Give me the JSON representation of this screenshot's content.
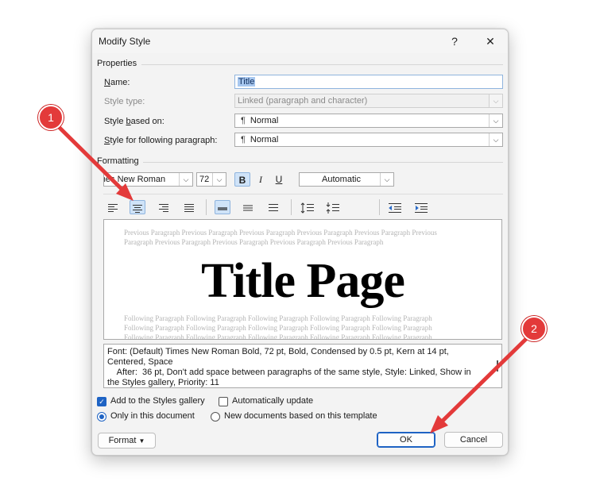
{
  "dialog": {
    "title": "Modify Style",
    "help_glyph": "?",
    "close_glyph": "✕"
  },
  "properties": {
    "group_label": "Properties",
    "name_label": "Name:",
    "name_value": "Title",
    "style_type_label": "Style type:",
    "style_type_value": "Linked (paragraph and character)",
    "based_on_label": "Style based on:",
    "based_on_value": "Normal",
    "following_label": "Style for following paragraph:",
    "following_value": "Normal",
    "para_glyph": "¶"
  },
  "formatting": {
    "group_label": "Formatting",
    "font_value": "Times New Roman",
    "size_value": "72",
    "bold_label": "B",
    "italic_label": "I",
    "underline_label": "U",
    "color_value": "Automatic"
  },
  "preview": {
    "previous_line1": "Previous Paragraph Previous Paragraph Previous Paragraph Previous Paragraph Previous Paragraph Previous",
    "previous_line2": "Paragraph Previous Paragraph Previous Paragraph Previous Paragraph Previous Paragraph",
    "title_text": "Title Page",
    "following_line1": "Following Paragraph Following Paragraph Following Paragraph Following Paragraph Following Paragraph",
    "following_line2": "Following Paragraph Following Paragraph Following Paragraph Following Paragraph Following Paragraph",
    "following_line3": "Following Paragraph Following Paragraph Following Paragraph Following Paragraph Following Paragraph"
  },
  "description": {
    "line1": "Font: (Default) Times New Roman Bold, 72 pt, Bold, Condensed by  0.5 pt, Kern at 14 pt,",
    "line2": "Centered, Space",
    "line3": "    After:  36 pt, Don't add space between paragraphs of the same style, Style: Linked, Show in",
    "line4": "the Styles gallery, Priority: 11"
  },
  "options": {
    "add_gallery_label": "Add to the Styles gallery",
    "add_gallery_checked": true,
    "auto_update_label": "Automatically update",
    "auto_update_checked": false,
    "only_doc_label": "Only in this document",
    "new_docs_label": "New documents based on this template"
  },
  "buttons": {
    "format_label": "Format",
    "ok_label": "OK",
    "cancel_label": "Cancel"
  },
  "callouts": {
    "one": "1",
    "two": "2"
  },
  "colors": {
    "callout_red": "#e33a3a",
    "accent_blue": "#1e63c4",
    "selection_blue": "#a8c8f0",
    "active_button_bg": "#cfe3f8"
  }
}
